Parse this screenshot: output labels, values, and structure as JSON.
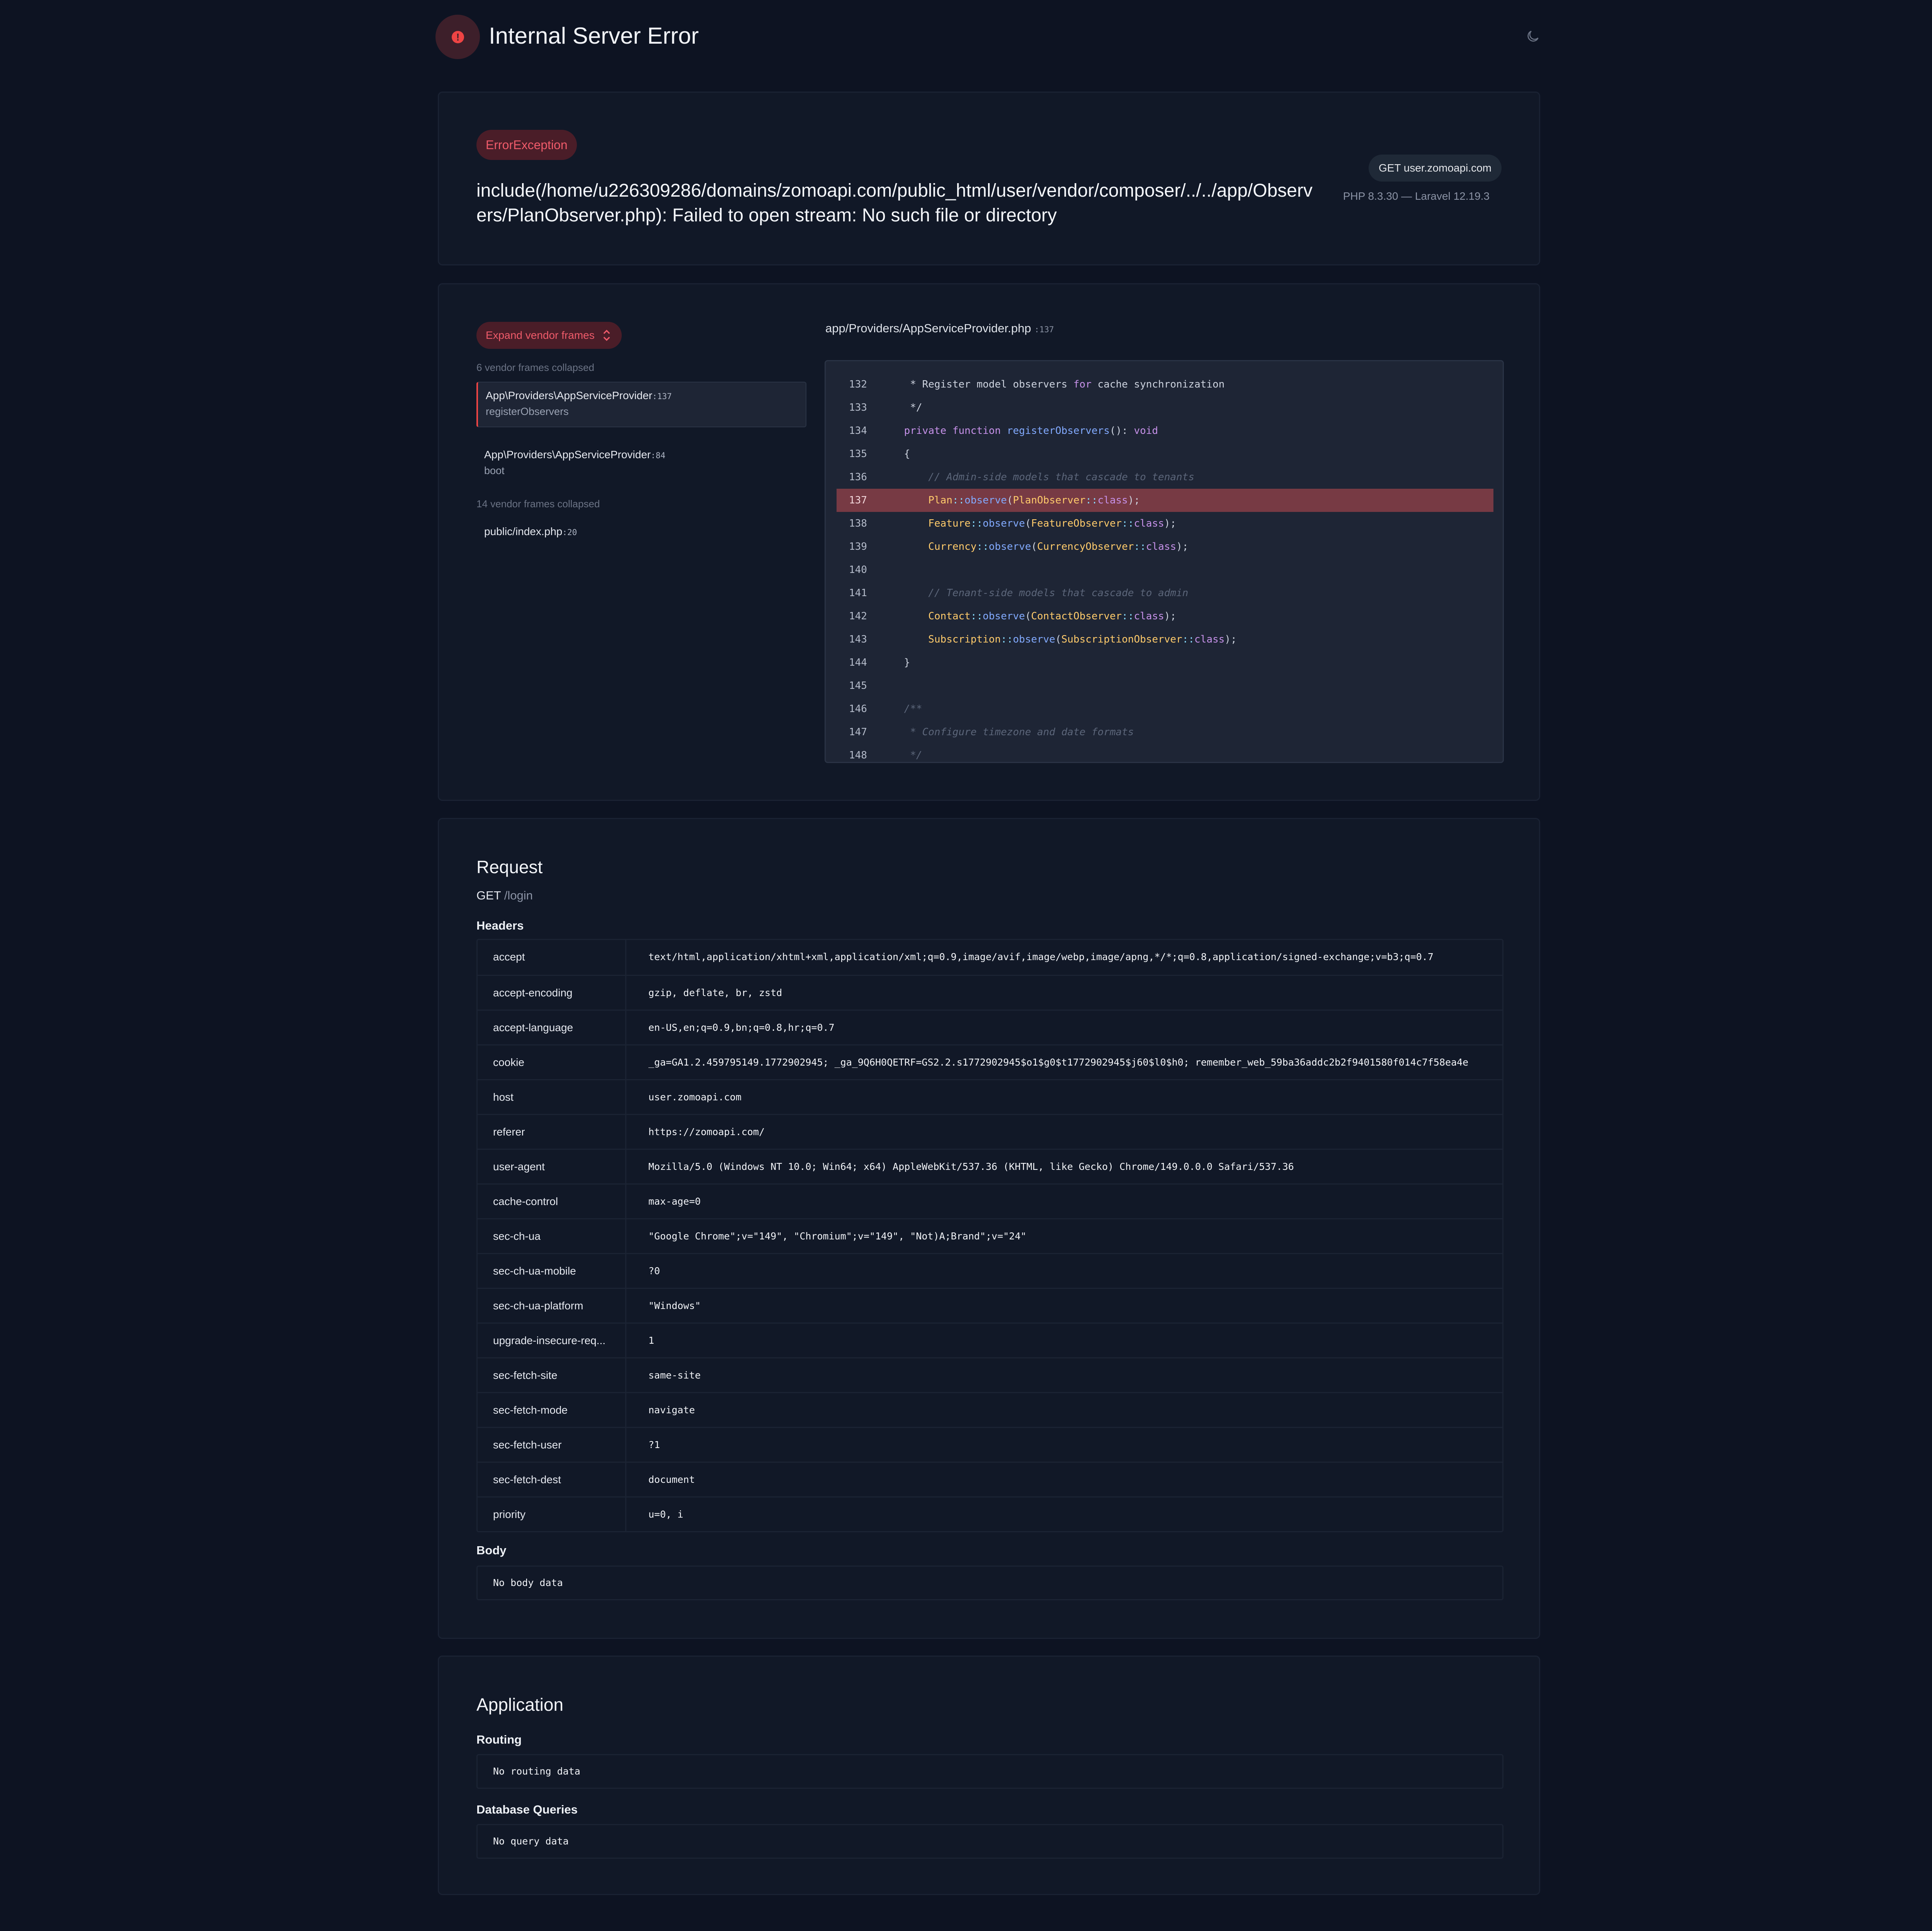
{
  "header": {
    "title": "Internal Server Error",
    "error_icon": "alert-circle-icon",
    "theme_icon": "moon-icon"
  },
  "exception": {
    "type": "ErrorException",
    "message": "include(/home/u226309286/domains/zomoapi.com/public_html/user/vendor/composer/../../app/Observers/PlanObserver.php): Failed to open stream: No such file or directory",
    "request_pill": "GET user.zomoapi.com",
    "versions": "PHP 8.3.30 — Laravel 12.19.3"
  },
  "trace": {
    "expand_label": "Expand vendor frames",
    "collapsed_1": "6 vendor frames collapsed",
    "collapsed_2": "14 vendor frames collapsed",
    "frames": [
      {
        "class": "App\\Providers\\AppServiceProvider",
        "line": ":137",
        "function": "registerObservers"
      },
      {
        "class": "App\\Providers\\AppServiceProvider",
        "line": ":84",
        "function": "boot"
      },
      {
        "class": "public/index.php",
        "line": ":20",
        "function": ""
      }
    ],
    "file_path": "app/Providers/AppServiceProvider.php",
    "file_line": ":137",
    "highlight_line": 137,
    "code": [
      {
        "n": "132",
        "t": [
          [
            "pl",
            "     * Register model observers "
          ],
          [
            "kw",
            "for"
          ],
          [
            "pl",
            " cache synchronization"
          ]
        ]
      },
      {
        "n": "133",
        "t": [
          [
            "pl",
            "     */"
          ]
        ]
      },
      {
        "n": "134",
        "t": [
          [
            "pl",
            "    "
          ],
          [
            "kw",
            "private function "
          ],
          [
            "fn",
            "registerObservers"
          ],
          [
            "pl",
            "(): "
          ],
          [
            "kw",
            "void"
          ]
        ]
      },
      {
        "n": "135",
        "t": [
          [
            "pl",
            "    {"
          ]
        ]
      },
      {
        "n": "136",
        "t": [
          [
            "pl",
            "        "
          ],
          [
            "cm",
            "// Admin-side models that cascade to tenants"
          ]
        ]
      },
      {
        "n": "137",
        "t": [
          [
            "pl",
            "        "
          ],
          [
            "cls",
            "Plan"
          ],
          [
            "op",
            "::"
          ],
          [
            "fn",
            "observe"
          ],
          [
            "pl",
            "("
          ],
          [
            "cls",
            "PlanObserver"
          ],
          [
            "op",
            "::"
          ],
          [
            "kw",
            "class"
          ],
          [
            "pl",
            ");"
          ]
        ]
      },
      {
        "n": "138",
        "t": [
          [
            "pl",
            "        "
          ],
          [
            "cls",
            "Feature"
          ],
          [
            "op",
            "::"
          ],
          [
            "fn",
            "observe"
          ],
          [
            "pl",
            "("
          ],
          [
            "cls",
            "FeatureObserver"
          ],
          [
            "op",
            "::"
          ],
          [
            "kw",
            "class"
          ],
          [
            "pl",
            ");"
          ]
        ]
      },
      {
        "n": "139",
        "t": [
          [
            "pl",
            "        "
          ],
          [
            "cls",
            "Currency"
          ],
          [
            "op",
            "::"
          ],
          [
            "fn",
            "observe"
          ],
          [
            "pl",
            "("
          ],
          [
            "cls",
            "CurrencyObserver"
          ],
          [
            "op",
            "::"
          ],
          [
            "kw",
            "class"
          ],
          [
            "pl",
            ");"
          ]
        ]
      },
      {
        "n": "140",
        "t": [
          [
            "pl",
            ""
          ]
        ]
      },
      {
        "n": "141",
        "t": [
          [
            "pl",
            "        "
          ],
          [
            "cm",
            "// Tenant-side models that cascade to admin"
          ]
        ]
      },
      {
        "n": "142",
        "t": [
          [
            "pl",
            "        "
          ],
          [
            "cls",
            "Contact"
          ],
          [
            "op",
            "::"
          ],
          [
            "fn",
            "observe"
          ],
          [
            "pl",
            "("
          ],
          [
            "cls",
            "ContactObserver"
          ],
          [
            "op",
            "::"
          ],
          [
            "kw",
            "class"
          ],
          [
            "pl",
            ");"
          ]
        ]
      },
      {
        "n": "143",
        "t": [
          [
            "pl",
            "        "
          ],
          [
            "cls",
            "Subscription"
          ],
          [
            "op",
            "::"
          ],
          [
            "fn",
            "observe"
          ],
          [
            "pl",
            "("
          ],
          [
            "cls",
            "SubscriptionObserver"
          ],
          [
            "op",
            "::"
          ],
          [
            "kw",
            "class"
          ],
          [
            "pl",
            ");"
          ]
        ]
      },
      {
        "n": "144",
        "t": [
          [
            "pl",
            "    }"
          ]
        ]
      },
      {
        "n": "145",
        "t": [
          [
            "pl",
            ""
          ]
        ]
      },
      {
        "n": "146",
        "t": [
          [
            "pl",
            "    "
          ],
          [
            "cm",
            "/**"
          ]
        ]
      },
      {
        "n": "147",
        "t": [
          [
            "pl",
            "     "
          ],
          [
            "cm",
            "* Configure timezone and date formats"
          ]
        ]
      },
      {
        "n": "148",
        "t": [
          [
            "pl",
            "     "
          ],
          [
            "cm",
            "*/"
          ]
        ]
      }
    ]
  },
  "request": {
    "title": "Request",
    "method": "GET",
    "path": "/login",
    "headers_title": "Headers",
    "headers": [
      {
        "key": "accept",
        "value": "text/html,application/xhtml+xml,application/xml;q=0.9,image/avif,image/webp,image/apng,*/*;q=0.8,application/signed-exchange;v=b3;q=0.7"
      },
      {
        "key": "accept-encoding",
        "value": "gzip, deflate, br, zstd"
      },
      {
        "key": "accept-language",
        "value": "en-US,en;q=0.9,bn;q=0.8,hr;q=0.7"
      },
      {
        "key": "cookie",
        "value": "_ga=GA1.2.459795149.1772902945; _ga_9Q6H0QETRF=GS2.2.s1772902945$o1$g0$t1772902945$j60$l0$h0; remember_web_59ba36addc2b2f9401580f014c7f58ea4e"
      },
      {
        "key": "host",
        "value": "user.zomoapi.com"
      },
      {
        "key": "referer",
        "value": "https://zomoapi.com/"
      },
      {
        "key": "user-agent",
        "value": "Mozilla/5.0 (Windows NT 10.0; Win64; x64) AppleWebKit/537.36 (KHTML, like Gecko) Chrome/149.0.0.0 Safari/537.36"
      },
      {
        "key": "cache-control",
        "value": "max-age=0"
      },
      {
        "key": "sec-ch-ua",
        "value": "\"Google Chrome\";v=\"149\", \"Chromium\";v=\"149\", \"Not)A;Brand\";v=\"24\""
      },
      {
        "key": "sec-ch-ua-mobile",
        "value": "?0"
      },
      {
        "key": "sec-ch-ua-platform",
        "value": "\"Windows\""
      },
      {
        "key": "upgrade-insecure-req...",
        "value": "1"
      },
      {
        "key": "sec-fetch-site",
        "value": "same-site"
      },
      {
        "key": "sec-fetch-mode",
        "value": "navigate"
      },
      {
        "key": "sec-fetch-user",
        "value": "?1"
      },
      {
        "key": "sec-fetch-dest",
        "value": "document"
      },
      {
        "key": "priority",
        "value": "u=0, i"
      }
    ],
    "body_title": "Body",
    "body_value": "No body data"
  },
  "application": {
    "title": "Application",
    "routing_title": "Routing",
    "routing_value": "No routing data",
    "db_title": "Database Queries",
    "db_value": "No query data"
  }
}
